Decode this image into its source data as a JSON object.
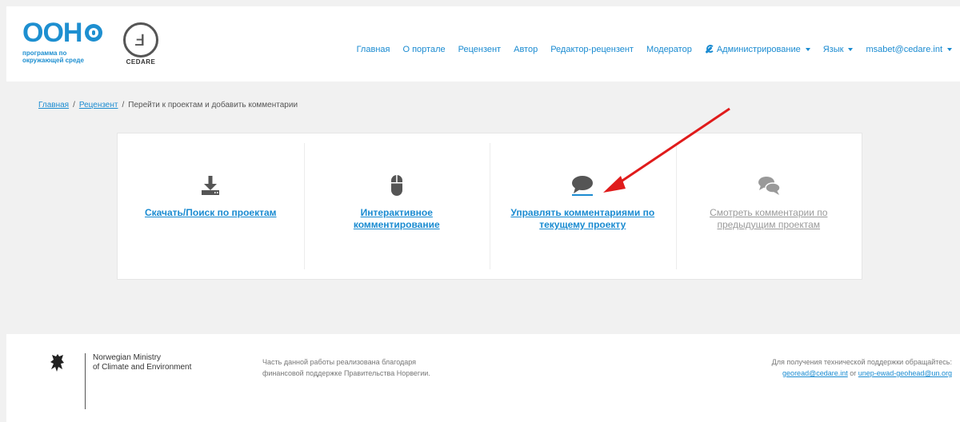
{
  "header": {
    "logo_big": "ООН",
    "logo_sub_line1": "программа по",
    "logo_sub_line2": "окружающей среде",
    "cedare_label": "CEDARE",
    "nav": [
      {
        "label": "Главная"
      },
      {
        "label": "О портале"
      },
      {
        "label": "Рецензент"
      },
      {
        "label": "Автор"
      },
      {
        "label": "Редактор-рецензент"
      },
      {
        "label": "Модератор"
      },
      {
        "label": "Администрирование"
      },
      {
        "label": "Язык"
      },
      {
        "label": "msabet@cedare.int"
      }
    ]
  },
  "breadcrumb": {
    "home": "Главная",
    "reviewer": "Рецензент",
    "current": "Перейти к проектам и добавить комментарии"
  },
  "cards": [
    {
      "icon": "download-icon",
      "label": "Скачать/Поиск по проектам"
    },
    {
      "icon": "mouse-icon",
      "label": "Интерактивное комментирование"
    },
    {
      "icon": "comment-icon",
      "label": "Управлять комментариями по текущему проекту"
    },
    {
      "icon": "comments-icon",
      "label": "Смотреть комментарии по предыдущим проектам"
    }
  ],
  "footer": {
    "ministry_line1": "Norwegian Ministry",
    "ministry_line2": "of Climate and Environment",
    "norway_line1": "Часть данной работы реализована благодаря",
    "norway_line2": "финансовой поддержке Правительства Норвегии.",
    "support_text": "Для получения технической поддержки обращайтесь:",
    "support_email1": "georead@cedare.int",
    "support_or": " or ",
    "support_email2": "unep-ewad-geohead@un.org"
  },
  "colors": {
    "link": "#1a8bd1",
    "logo": "#1e8fd0",
    "arrow": "#e01b1b",
    "disabled": "#9a9a9a"
  }
}
